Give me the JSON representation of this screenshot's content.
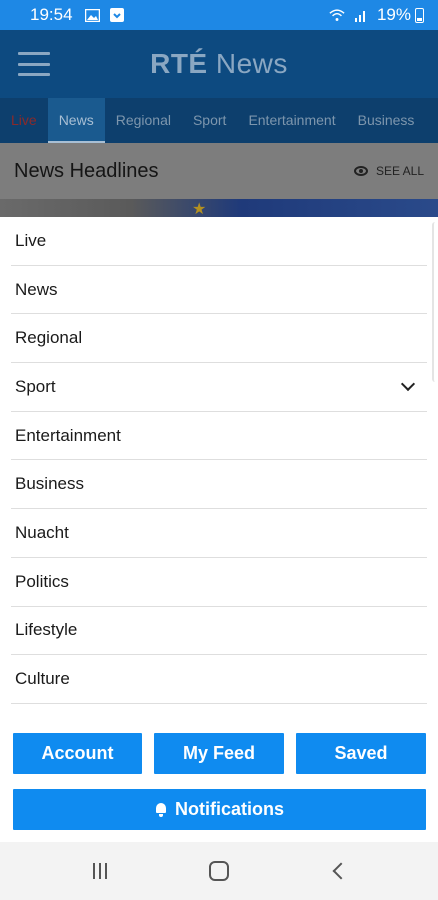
{
  "status_bar": {
    "time": "19:54",
    "battery": "19%"
  },
  "app_header": {
    "logo_brand": "RTÉ",
    "logo_suffix": "News"
  },
  "tabs": [
    {
      "label": "Live"
    },
    {
      "label": "News"
    },
    {
      "label": "Regional"
    },
    {
      "label": "Sport"
    },
    {
      "label": "Entertainment"
    },
    {
      "label": "Business"
    }
  ],
  "section": {
    "title": "News Headlines",
    "see_all": "SEE ALL"
  },
  "menu": {
    "items": [
      {
        "label": "Live"
      },
      {
        "label": "News"
      },
      {
        "label": "Regional"
      },
      {
        "label": "Sport",
        "expandable": true
      },
      {
        "label": "Entertainment"
      },
      {
        "label": "Business"
      },
      {
        "label": "Nuacht"
      },
      {
        "label": "Politics"
      },
      {
        "label": "Lifestyle"
      },
      {
        "label": "Culture"
      }
    ]
  },
  "buttons": {
    "account": "Account",
    "my_feed": "My Feed",
    "saved": "Saved",
    "notifications": "Notifications"
  },
  "colors": {
    "accent": "#0f8bf0",
    "status_bar": "#1e88e5",
    "header": "#0d4a80"
  }
}
